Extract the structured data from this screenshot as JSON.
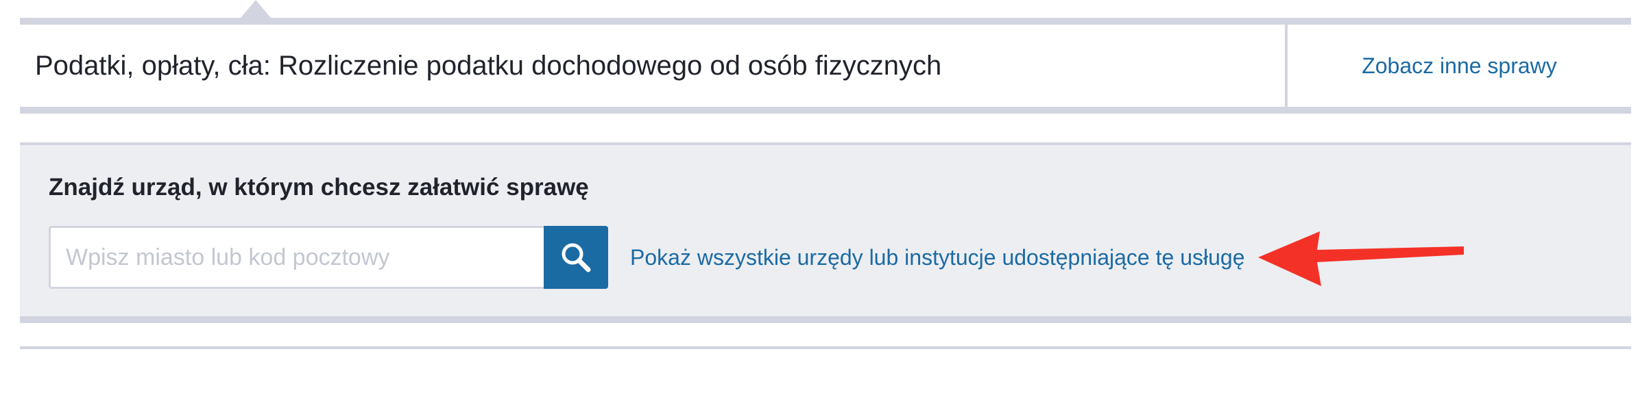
{
  "header": {
    "title": "Podatki, opłaty, cła: Rozliczenie podatku dochodowego od osób fizycznych",
    "other_cases_link": "Zobacz inne sprawy"
  },
  "search_panel": {
    "heading": "Znajdź urząd, w którym chcesz załatwić sprawę",
    "input_value": "",
    "input_placeholder": "Wpisz miasto lub kod pocztowy",
    "search_button_icon": "magnifier-icon",
    "all_offices_link": "Pokaż wszystkie urzędy lub instytucje udostępniające tę usługę"
  },
  "annotation": {
    "arrow_icon": "arrow-left-icon",
    "arrow_color": "#f43127"
  },
  "colors": {
    "link": "#1a6aa4",
    "border": "#d2d5df",
    "panel_background": "#edeef2",
    "text": "#20232b"
  }
}
